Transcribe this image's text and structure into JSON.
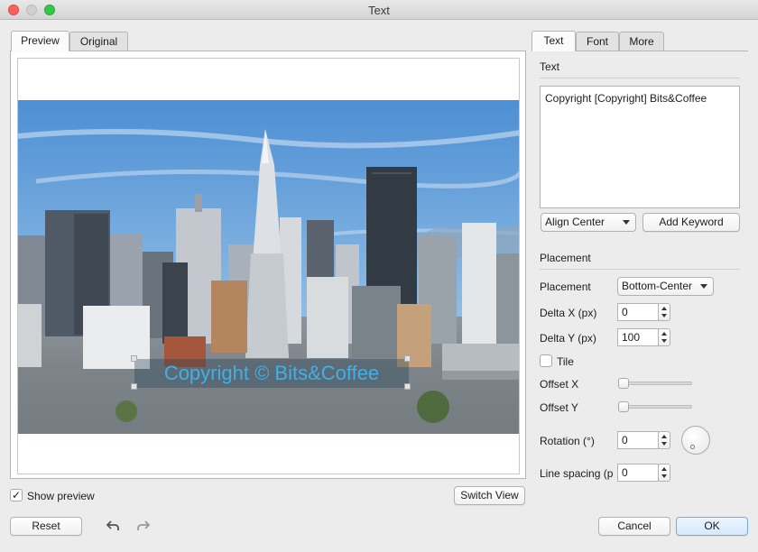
{
  "window": {
    "title": "Text"
  },
  "preview": {
    "tabs": [
      "Preview",
      "Original"
    ],
    "watermark_text": "Copyright © Bits&Coffee",
    "show_preview_label": "Show preview",
    "show_preview_checked": "✓",
    "switch_view_label": "Switch View"
  },
  "settings": {
    "tabs": [
      "Text",
      "Font",
      "More"
    ],
    "text_section_title": "Text",
    "text_value": "Copyright [Copyright] Bits&Coffee",
    "align": "Align Center",
    "add_keyword_label": "Add Keyword",
    "placement_section_title": "Placement",
    "placement_label": "Placement",
    "placement_value": "Bottom-Center",
    "delta_x_label": "Delta X (px)",
    "delta_x_value": "0",
    "delta_y_label": "Delta Y (px)",
    "delta_y_value": "100",
    "tile_label": "Tile",
    "offset_x_label": "Offset X",
    "offset_y_label": "Offset Y",
    "rotation_label": "Rotation (°)",
    "rotation_value": "0",
    "line_spacing_label": "Line spacing (p",
    "line_spacing_value": "0"
  },
  "footer": {
    "reset_label": "Reset",
    "undo_icon": "undo-icon",
    "redo_icon": "redo-icon",
    "cancel_label": "Cancel",
    "ok_label": "OK"
  }
}
